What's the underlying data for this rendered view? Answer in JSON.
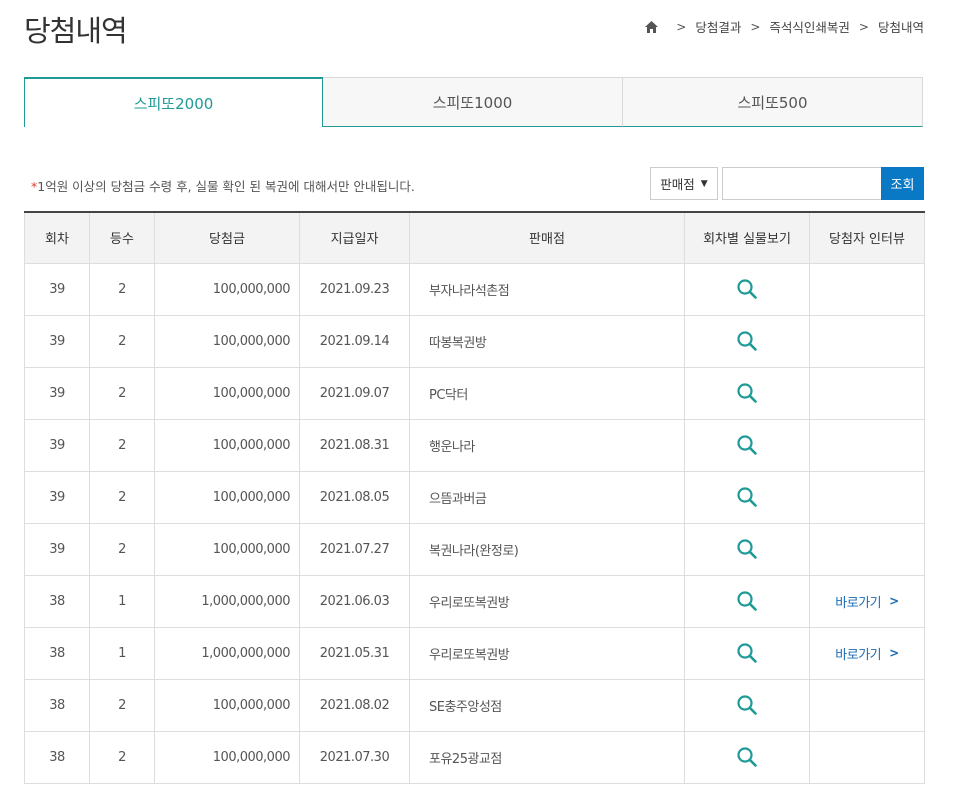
{
  "page": {
    "title": "당첨내역"
  },
  "breadcrumb": {
    "items": [
      "당첨결과",
      "즉석식인쇄복권",
      "당첨내역"
    ],
    "separator": ">"
  },
  "tabs": [
    {
      "label": "스피또2000",
      "active": true
    },
    {
      "label": "스피또1000",
      "active": false
    },
    {
      "label": "스피또500",
      "active": false
    }
  ],
  "notice": {
    "mark": "*",
    "text": "1억원 이상의 당첨금 수령 후, 실물 확인 된 복권에 대해서만 안내됩니다."
  },
  "search": {
    "select_label": "판매점",
    "input_value": "",
    "button_label": "조회"
  },
  "table": {
    "headers": [
      "회차",
      "등수",
      "당첨금",
      "지급일자",
      "판매점",
      "회차별 실물보기",
      "당첨자 인터뷰"
    ],
    "rows": [
      {
        "round": "39",
        "rank": "2",
        "amount": "100,000,000",
        "date": "2021.09.23",
        "store": "부자나라석촌점",
        "interview": ""
      },
      {
        "round": "39",
        "rank": "2",
        "amount": "100,000,000",
        "date": "2021.09.14",
        "store": "따봉복권방",
        "interview": ""
      },
      {
        "round": "39",
        "rank": "2",
        "amount": "100,000,000",
        "date": "2021.09.07",
        "store": "PC닥터",
        "interview": ""
      },
      {
        "round": "39",
        "rank": "2",
        "amount": "100,000,000",
        "date": "2021.08.31",
        "store": "행운나라",
        "interview": ""
      },
      {
        "round": "39",
        "rank": "2",
        "amount": "100,000,000",
        "date": "2021.08.05",
        "store": "으뜸과버금",
        "interview": ""
      },
      {
        "round": "39",
        "rank": "2",
        "amount": "100,000,000",
        "date": "2021.07.27",
        "store": "복권나라(완정로)",
        "interview": ""
      },
      {
        "round": "38",
        "rank": "1",
        "amount": "1,000,000,000",
        "date": "2021.06.03",
        "store": "우리로또복권방",
        "interview": "바로가기"
      },
      {
        "round": "38",
        "rank": "1",
        "amount": "1,000,000,000",
        "date": "2021.05.31",
        "store": "우리로또복권방",
        "interview": "바로가기"
      },
      {
        "round": "38",
        "rank": "2",
        "amount": "100,000,000",
        "date": "2021.08.02",
        "store": "SE충주앙성점",
        "interview": ""
      },
      {
        "round": "38",
        "rank": "2",
        "amount": "100,000,000",
        "date": "2021.07.30",
        "store": "포유25광교점",
        "interview": ""
      }
    ]
  },
  "colors": {
    "accent": "#1f9a96",
    "button": "#0a79c5",
    "link": "#1b6cb4",
    "notice_mark": "#e03c31"
  },
  "icons": {
    "home": "home-icon",
    "view": "magnifier-icon",
    "link": "chevron-right-icon"
  }
}
